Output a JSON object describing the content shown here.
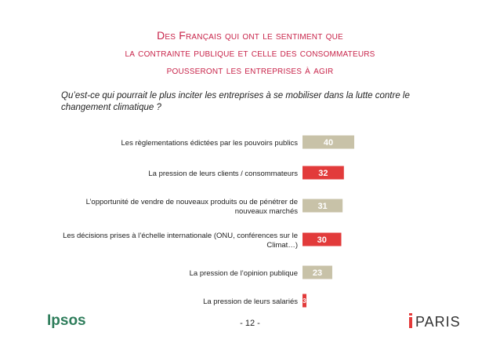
{
  "title": {
    "line1": "Des Français qui ont le sentiment que",
    "line2": "la contrainte publique et celle des consommateurs",
    "line3": "pousseront les entreprises à agir"
  },
  "question": "Qu’est-ce qui pourrait le plus inciter les entreprises à se mobiliser dans la lutte contre le changement climatique ?",
  "chart_data": {
    "type": "bar",
    "orientation": "horizontal",
    "xlim": [
      0,
      100
    ],
    "categories": [
      "Les règlementations édictées par les pouvoirs publics",
      "La pression de leurs clients / consommateurs",
      "L’opportunité de vendre de nouveaux produits ou de pénétrer de nouveaux marchés",
      "Les décisions prises à l’échelle internationale (ONU, conférences sur le Climat…)",
      "La pression de l’opinion publique",
      "La pression de leurs salariés"
    ],
    "category_lines": [
      [
        "Les règlementations édictées par les pouvoirs publics"
      ],
      [
        "La pression de leurs clients / consommateurs"
      ],
      [
        "L’opportunité de vendre de nouveaux produits ou de pénétrer de",
        "nouveaux marchés"
      ],
      [
        "Les décisions prises à l’échelle internationale (ONU, conférences sur le",
        "Climat…)"
      ],
      [
        "La pression de l’opinion publique"
      ],
      [
        "La pression de leurs salariés"
      ]
    ],
    "values": [
      40,
      32,
      31,
      30,
      23,
      3
    ],
    "colors": [
      "#c8c2a8",
      "#e23b3b",
      "#c8c2a8",
      "#e23b3b",
      "#c8c2a8",
      "#e23b3b"
    ],
    "label_color": "#ffffff"
  },
  "footer": {
    "brand": "Ipsos",
    "page": "- 12 -",
    "city": "PARIS"
  },
  "colors": {
    "title": "#c8244a",
    "brand": "#2e7d5b",
    "accent_red": "#e43a3a"
  }
}
